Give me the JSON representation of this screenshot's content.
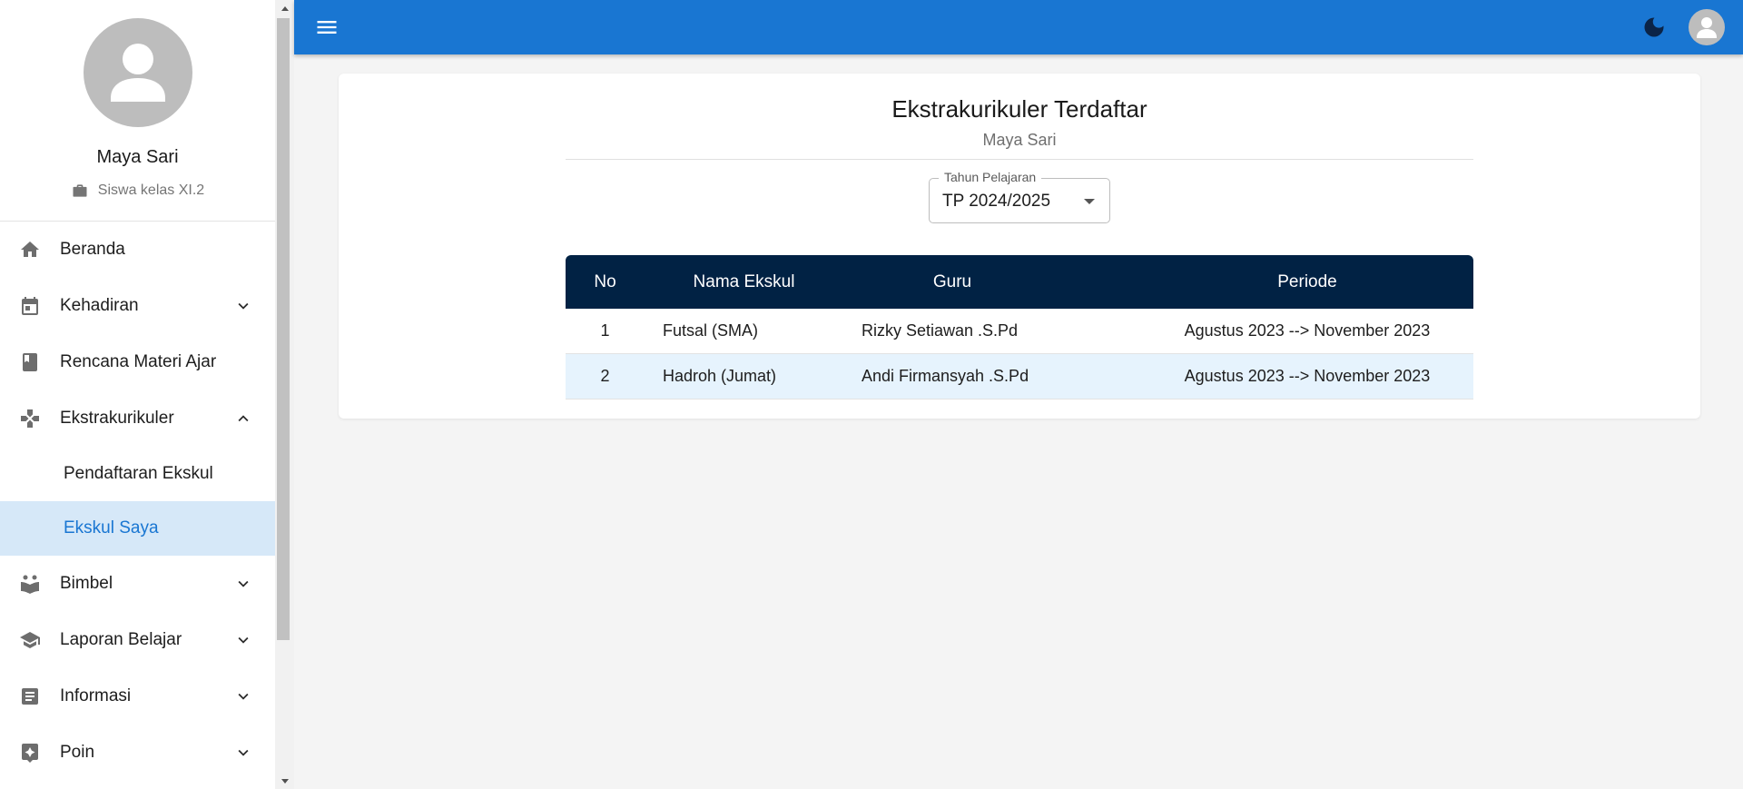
{
  "profile": {
    "name": "Maya Sari",
    "role": "Siswa kelas XI.2"
  },
  "sidebar": {
    "items": [
      {
        "label": "Beranda",
        "icon": "home-icon",
        "expandable": false
      },
      {
        "label": "Kehadiran",
        "icon": "calendar-icon",
        "expandable": true,
        "expanded": false
      },
      {
        "label": "Rencana Materi Ajar",
        "icon": "book-icon",
        "expandable": false
      },
      {
        "label": "Ekstrakurikuler",
        "icon": "gamepad-icon",
        "expandable": true,
        "expanded": true,
        "children": [
          {
            "label": "Pendaftaran Ekskul",
            "active": false
          },
          {
            "label": "Ekskul Saya",
            "active": true
          }
        ]
      },
      {
        "label": "Bimbel",
        "icon": "reading-icon",
        "expandable": true,
        "expanded": false
      },
      {
        "label": "Laporan Belajar",
        "icon": "school-icon",
        "expandable": true,
        "expanded": false
      },
      {
        "label": "Informasi",
        "icon": "article-icon",
        "expandable": true,
        "expanded": false
      },
      {
        "label": "Poin",
        "icon": "star-badge-icon",
        "expandable": true,
        "expanded": false
      }
    ]
  },
  "topbar": {
    "color": "#1976d2",
    "icons": [
      "menu-icon",
      "moon-icon",
      "account-icon"
    ]
  },
  "main": {
    "title": "Ekstrakurikuler Terdaftar",
    "subtitle": "Maya Sari",
    "select": {
      "legend": "Tahun Pelajaran",
      "value": "TP 2024/2025"
    },
    "table": {
      "header_color": "#012244",
      "columns": [
        "No",
        "Nama Ekskul",
        "Guru",
        "Periode"
      ],
      "rows": [
        [
          "1",
          "Futsal (SMA)",
          "Rizky Setiawan .S.Pd",
          "Agustus 2023 --> November 2023"
        ],
        [
          "2",
          "Hadroh (Jumat)",
          "Andi Firmansyah .S.Pd",
          "Agustus 2023 --> November 2023"
        ]
      ]
    }
  }
}
